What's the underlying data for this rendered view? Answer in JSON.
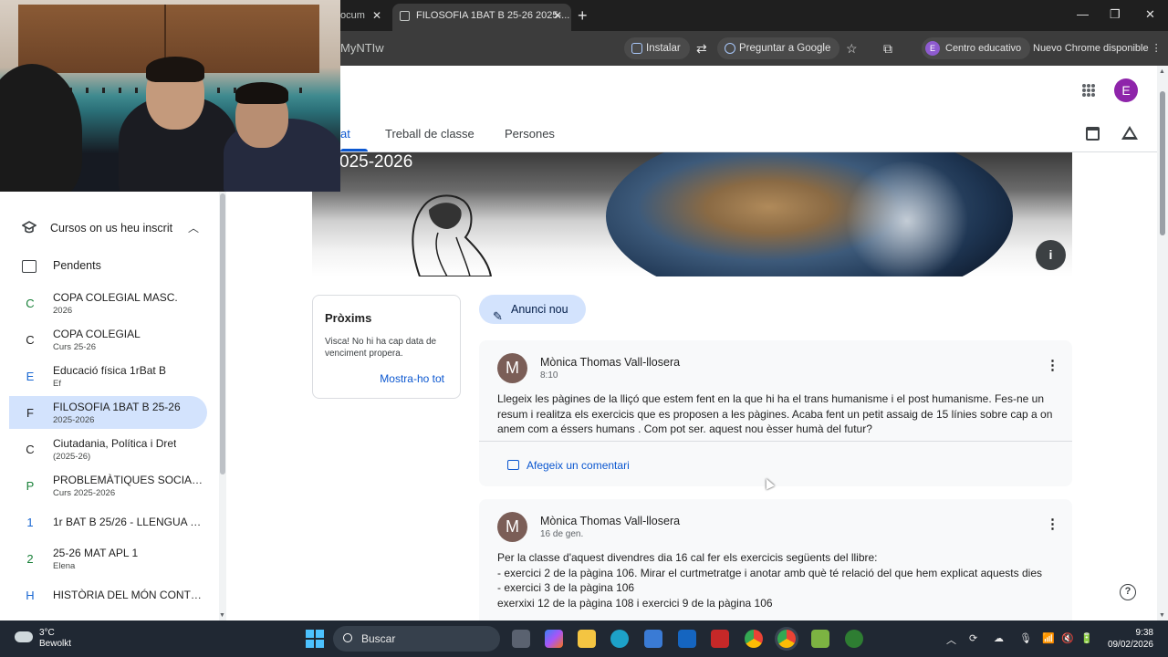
{
  "browser": {
    "prev_tab_title": "ocum",
    "active_tab_title": "FILOSOFIA 1BAT B 25-26 2025-...",
    "new_tab_symbol": "+",
    "url_fragment": "MyNTIw",
    "install_label": "Instalar",
    "ask_google_label": "Preguntar a Google",
    "profile_label": "Centro educativo",
    "profile_initial": "E",
    "new_chrome_label": "Nuevo Chrome disponible"
  },
  "header": {
    "user_initial": "E"
  },
  "tabs": {
    "stream_fragment": "at",
    "classwork": "Treball de classe",
    "people": "Persones"
  },
  "banner": {
    "title_fragment": "025-2026"
  },
  "sidebar": {
    "section_label": "Cursos on us heu inscrit",
    "pending_label": "Pendents",
    "courses": [
      {
        "letter": "C",
        "name": "COPA COLEGIAL MASC.",
        "sub": "2026",
        "color": "#188038"
      },
      {
        "letter": "C",
        "name": "COPA COLEGIAL",
        "sub": "Curs 25-26",
        "color": "#1f1f1f"
      },
      {
        "letter": "E",
        "name": "Educació física 1rBat B",
        "sub": "Ef",
        "color": "#1967d2"
      },
      {
        "letter": "F",
        "name": "FILOSOFIA 1BAT B 25-26",
        "sub": "2025-2026",
        "color": "#1f1f1f"
      },
      {
        "letter": "C",
        "name": "Ciutadania, Política i Dret",
        "sub": "(2025-26)",
        "color": "#1f1f1f"
      },
      {
        "letter": "P",
        "name": "PROBLEMÀTIQUES SOCIAL...",
        "sub": "Curs 2025-2026",
        "color": "#188038"
      },
      {
        "letter": "1",
        "name": "1r BAT B 25/26 - LLENGUA C...",
        "sub": "",
        "color": "#1967d2"
      },
      {
        "letter": "2",
        "name": "25-26 MAT APL 1",
        "sub": "Elena",
        "color": "#188038"
      },
      {
        "letter": "H",
        "name": "HISTÒRIA DEL MÓN CONTE...",
        "sub": "",
        "color": "#1967d2"
      }
    ]
  },
  "upcoming": {
    "title": "Pròxims",
    "description": "Visca! No hi ha cap data de venciment propera.",
    "view_all": "Mostra-ho tot"
  },
  "new_announcement_label": "Anunci nou",
  "posts": [
    {
      "initial": "M",
      "author": "Mònica Thomas Vall-llosera",
      "date": "8:10",
      "lines": [
        "Llegeix les pàgines de la lliçó que estem fent en la que hi ha el trans humanisme i el post humanisme. Fes-ne un",
        "resum i realitza els exercicis que es proposen a les pàgines. Acaba fent un petit assaig de 15 línies sobre cap a on",
        "anem com a éssers humans . Com pot ser. aquest nou èsser humà del futur?"
      ],
      "comment_label": "Afegeix un comentari"
    },
    {
      "initial": "M",
      "author": "Mònica Thomas Vall-llosera",
      "date": "16 de gen.",
      "lines": [
        "Per la classe d'aquest divendres dia 16 cal fer els exercicis següents del llibre:",
        "- exercici 2 de la pàgina 106. Mirar el curtmetratge i anotar amb què té relació del que hem explicat aquests dies",
        "- exercici 3 de la pàgina 106",
        "exerxixi 12 de la pàgina 108 i exercici 9 de la pàgina 106"
      ]
    }
  ],
  "taskbar": {
    "temperature": "3°C",
    "weather": "Bewolkt",
    "search_label": "Buscar",
    "time": "9:38",
    "date": "09/02/2026"
  }
}
